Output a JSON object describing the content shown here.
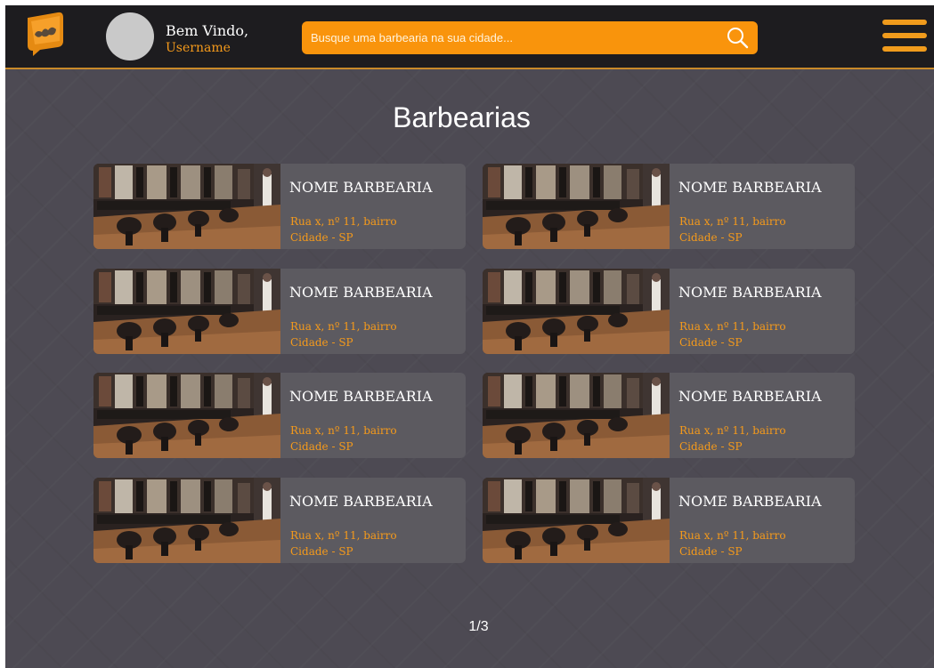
{
  "header": {
    "welcome_text": "Bem Vindo,",
    "username": "Username",
    "search_placeholder": "Busque uma barbearia na sua cidade...",
    "accent_color": "#f9940c"
  },
  "page": {
    "title": "Barbearias",
    "pagination": "1/3"
  },
  "barbershops": [
    {
      "name": "NOME BARBEARIA",
      "address": "Rua x, nº 11, bairro",
      "city": "Cidade - SP"
    },
    {
      "name": "NOME BARBEARIA",
      "address": "Rua x, nº 11, bairro",
      "city": "Cidade - SP"
    },
    {
      "name": "NOME BARBEARIA",
      "address": "Rua x, nº 11, bairro",
      "city": "Cidade - SP"
    },
    {
      "name": "NOME BARBEARIA",
      "address": "Rua x, nº 11, bairro",
      "city": "Cidade - SP"
    },
    {
      "name": "NOME BARBEARIA",
      "address": "Rua x, nº 11, bairro",
      "city": "Cidade - SP"
    },
    {
      "name": "NOME BARBEARIA",
      "address": "Rua x, nº 11, bairro",
      "city": "Cidade - SP"
    },
    {
      "name": "NOME BARBEARIA",
      "address": "Rua x, nº 11, bairro",
      "city": "Cidade - SP"
    },
    {
      "name": "NOME BARBEARIA",
      "address": "Rua x, nº 11, bairro",
      "city": "Cidade - SP"
    }
  ],
  "icons": {
    "logo": "mustache-chat-logo-icon",
    "search": "search-icon",
    "menu": "hamburger-menu-icon"
  }
}
